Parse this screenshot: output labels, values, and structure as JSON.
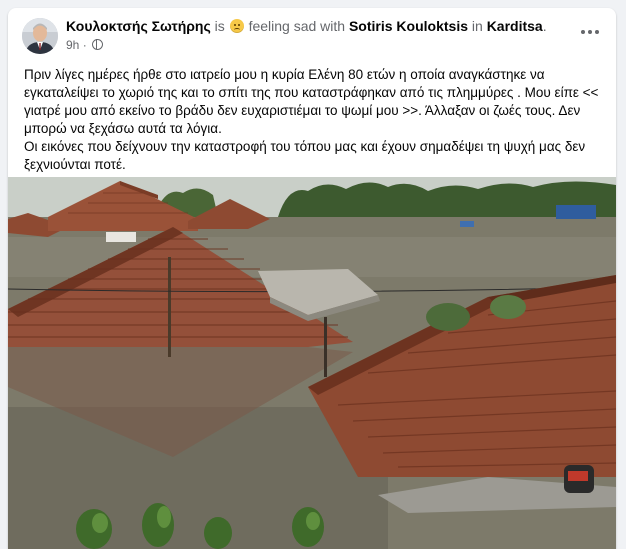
{
  "post": {
    "author": "Κουλοκτσής Σωτήρης",
    "verb": "is",
    "feeling": "feeling sad with",
    "tagged": "Sotiris Kouloktsis",
    "in_word": "in",
    "location": "Karditsa",
    "period": ".",
    "time": "9h",
    "time_sep": "·",
    "paragraph1": "Πριν λίγες ημέρες ήρθε στο ιατρείο μου η κυρία Ελένη 80 ετών η οποία αναγκάστηκε να εγκαταλείψει το χωριό της και το σπίτι της που καταστράφηκαν  από τις πλημμύρες . Μου είπε << γιατρέ μου από εκείνο το βράδυ δεν ευχαριστιέμαι το ψωμί μου >>. Άλλαξαν οι ζωές τους. Δεν μπορώ να ξεχάσω αυτά τα λόγια.",
    "paragraph2": "Οι εικόνες που δείχνουν την καταστροφή του τόπου μας και έχουν σημαδέψει τη ψυχή μας δεν ξεχνιούνται ποτέ."
  },
  "icons": {
    "feeling": "sad-face-emoji-icon",
    "audience": "globe-icon",
    "menu": "more-options-icon"
  },
  "colors": {
    "background": "#f0f2f5",
    "card": "#ffffff",
    "primary_text": "#050505",
    "secondary_text": "#65676b",
    "flood_water": "#7d7a6a",
    "roof_tiles": "#8e4a32"
  }
}
